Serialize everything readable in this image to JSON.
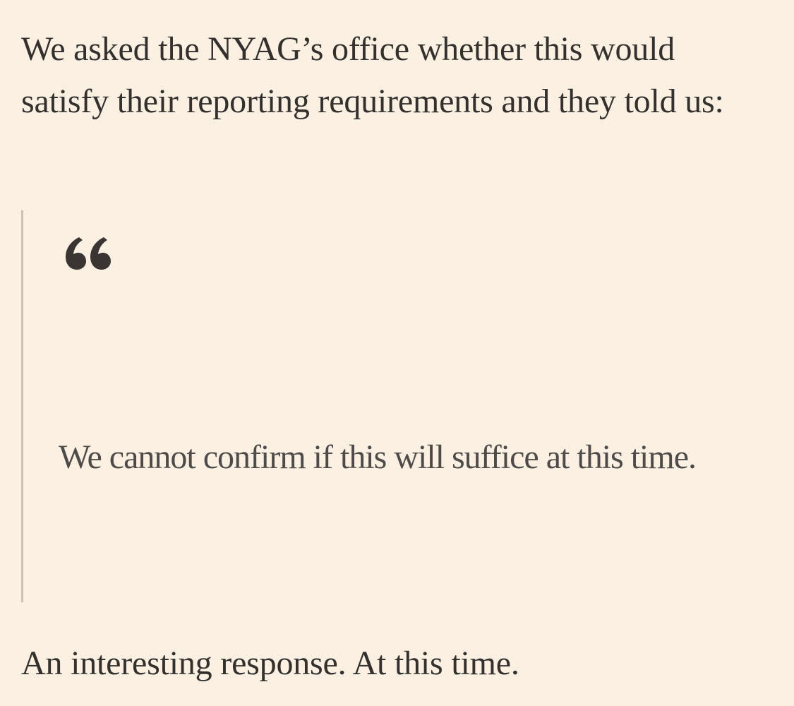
{
  "article": {
    "intro_text": "We asked the NYAG’s office whether this would satisfy their reporting requirements and they told us:",
    "quote": {
      "icon": "open-quote-icon",
      "text": "We cannot confirm if this will suffice at this time."
    },
    "closing_text": "An interesting response. At this time."
  },
  "colors": {
    "background": "#FCF0E3",
    "body_text": "#33302E",
    "quote_text": "#4F4B49",
    "quote_rule": "#CCC1B7"
  }
}
